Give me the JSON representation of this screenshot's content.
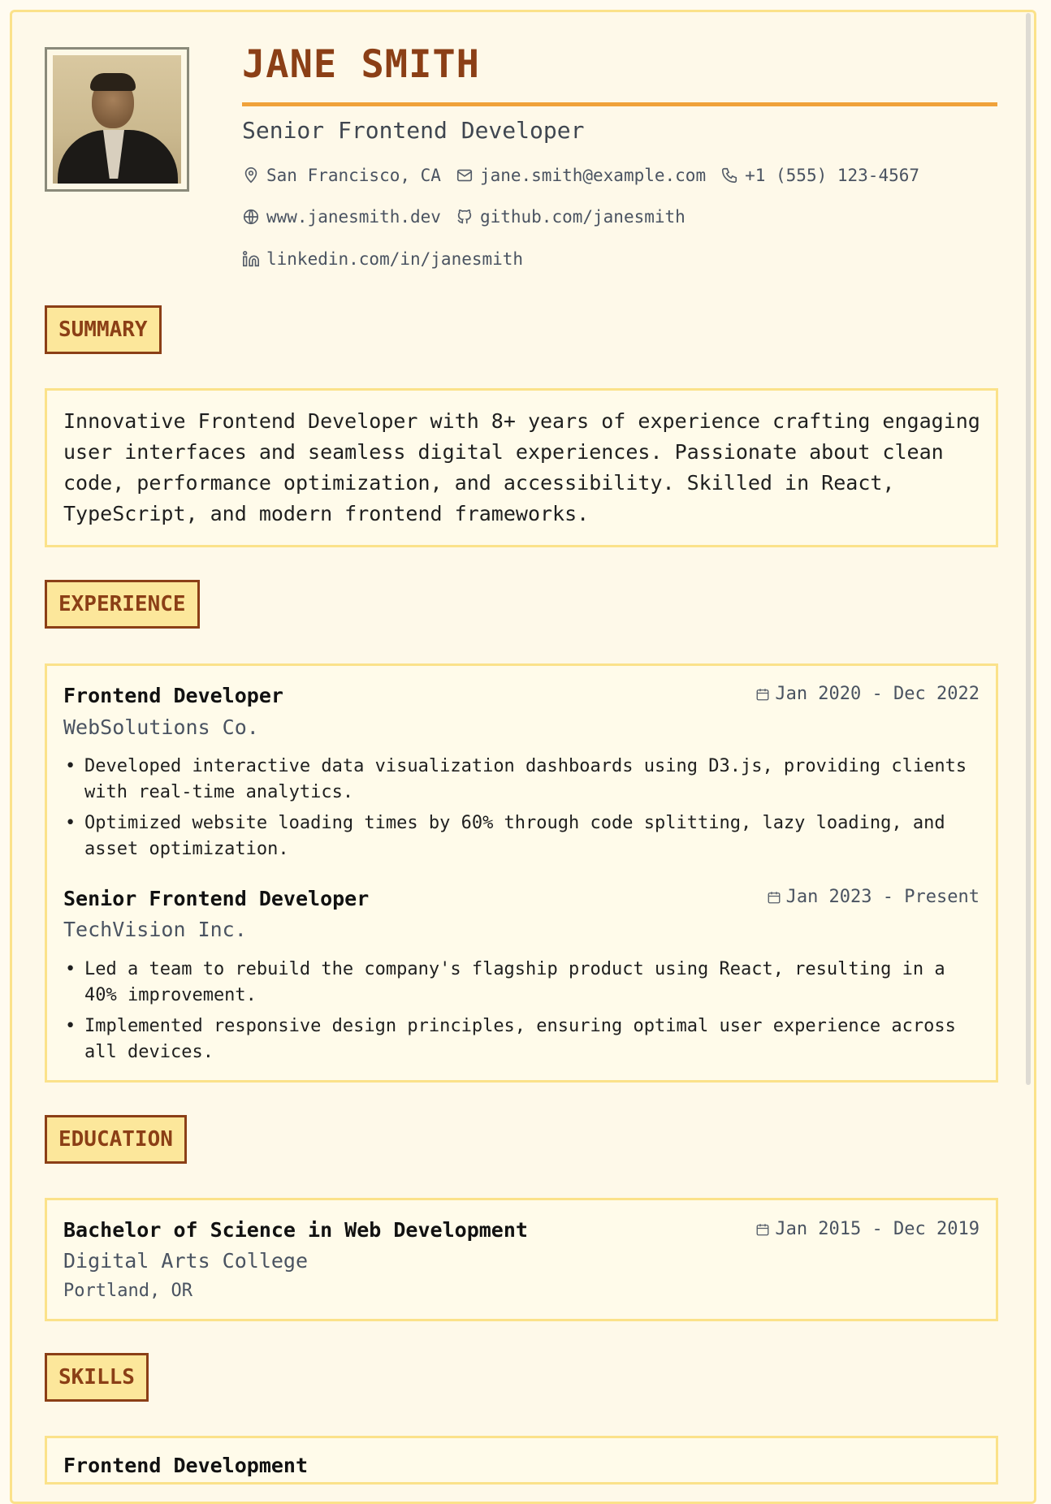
{
  "header": {
    "name": "JANE SMITH",
    "title": "Senior Frontend Developer",
    "contacts": {
      "location": "San Francisco, CA",
      "email": "jane.smith@example.com",
      "phone": "+1 (555) 123-4567",
      "website": "www.janesmith.dev",
      "github": "github.com/janesmith",
      "linkedin": "linkedin.com/in/janesmith"
    }
  },
  "sections": {
    "summary": "SUMMARY",
    "experience": "EXPERIENCE",
    "education": "EDUCATION",
    "skills": "SKILLS"
  },
  "summary": {
    "text": "Innovative Frontend Developer with 8+ years of experience crafting engaging user interfaces and seamless digital experiences. Passionate about clean code, performance optimization, and accessibility. Skilled in React, TypeScript, and modern frontend frameworks."
  },
  "experience": [
    {
      "title": "Frontend Developer",
      "company": "WebSolutions Co.",
      "dates": "Jan 2020 - Dec 2022",
      "bullets": [
        "Developed interactive data visualization dashboards using D3.js, providing clients with real-time analytics.",
        "Optimized website loading times by 60% through code splitting, lazy loading, and asset optimization."
      ]
    },
    {
      "title": "Senior Frontend Developer",
      "company": "TechVision Inc.",
      "dates": "Jan 2023 - Present",
      "bullets": [
        "Led a team to rebuild the company's flagship product using React, resulting in a 40% improvement.",
        "Implemented responsive design principles, ensuring optimal user experience across all devices."
      ]
    }
  ],
  "education": {
    "degree": "Bachelor of Science in Web Development",
    "school": "Digital Arts College",
    "location": "Portland, OR",
    "dates": "Jan 2015 - Dec 2019"
  },
  "skills": {
    "first_group": "Frontend Development"
  },
  "icons": {
    "location": "map-pin-icon",
    "email": "mail-icon",
    "phone": "phone-icon",
    "website": "globe-icon",
    "github": "github-icon",
    "linkedin": "linkedin-icon",
    "date": "calendar-icon"
  },
  "colors": {
    "accent": "#8b3f16",
    "rule": "#f0a23a",
    "label_bg": "#fce79b",
    "box_border": "#fbe28a",
    "background": "#fef9e9"
  }
}
